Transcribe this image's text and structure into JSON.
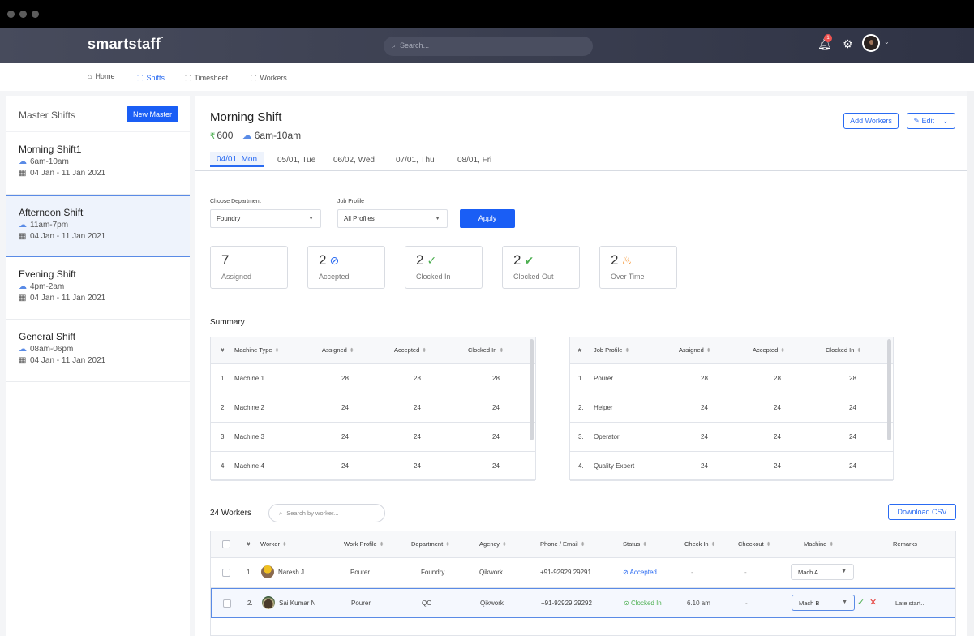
{
  "app": {
    "brand": "smartstaff",
    "search_placeholder": "Search...",
    "notification_count": "1"
  },
  "nav": {
    "items": [
      {
        "label": "Home",
        "icon": "home-icon"
      },
      {
        "label": "Shifts",
        "icon": "grid-icon",
        "active": true
      },
      {
        "label": "Timesheet",
        "icon": "grid-icon"
      },
      {
        "label": "Workers",
        "icon": "grid-icon"
      }
    ]
  },
  "sidebar": {
    "title": "Master Shifts",
    "new_button": "New Master",
    "shifts": [
      {
        "name": "Morning Shift1",
        "time": "6am-10am",
        "dates": "04 Jan - 11 Jan 2021"
      },
      {
        "name": "Afternoon Shift",
        "time": "11am-7pm",
        "dates": "04 Jan - 11 Jan 2021",
        "active": true
      },
      {
        "name": "Evening Shift",
        "time": "4pm-2am",
        "dates": "04 Jan - 11 Jan 2021"
      },
      {
        "name": "General Shift",
        "time": "08am-06pm",
        "dates": "04 Jan - 11 Jan 2021"
      }
    ]
  },
  "main": {
    "title": "Morning Shift",
    "rate": "600",
    "time": "6am-10am",
    "add_workers": "Add Workers",
    "edit": "Edit",
    "tabs": [
      "04/01, Mon",
      "05/01, Tue",
      "06/02, Wed",
      "07/01, Thu",
      "08/01, Fri"
    ],
    "filters": {
      "department_label": "Choose Department",
      "department_value": "Foundry",
      "profile_label": "Job Profile",
      "profile_value": "All Profiles",
      "apply": "Apply"
    },
    "stats": [
      {
        "value": "7",
        "label": "Assigned"
      },
      {
        "value": "2",
        "label": "Accepted",
        "icon": "check-circle-icon",
        "color": "#2a6bf2"
      },
      {
        "value": "2",
        "label": "Clocked In",
        "icon": "dashed-check-icon",
        "color": "#4caf50"
      },
      {
        "value": "2",
        "label": "Clocked Out",
        "icon": "filled-check-icon",
        "color": "#4caf50"
      },
      {
        "value": "2",
        "label": "Over Time",
        "icon": "flame-icon",
        "color": "#f57c00"
      }
    ],
    "summary_title": "Summary",
    "machine_table": {
      "headers": [
        "#",
        "Machine Type",
        "Assigned",
        "Accepted",
        "Clocked In"
      ],
      "rows": [
        [
          "1.",
          "Machine 1",
          "28",
          "28",
          "28"
        ],
        [
          "2.",
          "Machine 2",
          "24",
          "24",
          "24"
        ],
        [
          "3.",
          "Machine 3",
          "24",
          "24",
          "24"
        ],
        [
          "4.",
          "Machine 4",
          "24",
          "24",
          "24"
        ]
      ]
    },
    "profile_table": {
      "headers": [
        "#",
        "Job Profile",
        "Assigned",
        "Accepted",
        "Clocked In"
      ],
      "rows": [
        [
          "1.",
          "Pourer",
          "28",
          "28",
          "28"
        ],
        [
          "2.",
          "Helper",
          "24",
          "24",
          "24"
        ],
        [
          "3.",
          "Operator",
          "24",
          "24",
          "24"
        ],
        [
          "4.",
          "Quality Expert",
          "24",
          "24",
          "24"
        ]
      ]
    },
    "workers": {
      "count_label": "24 Workers",
      "search_placeholder": "Search by worker...",
      "download": "Download CSV",
      "headers": [
        "#",
        "Worker",
        "Work Profile",
        "Department",
        "Agency",
        "Phone / Email",
        "Status",
        "Check In",
        "Checkout",
        "Machine",
        "Remarks"
      ],
      "rows": [
        {
          "num": "1.",
          "name": "Naresh J",
          "profile": "Pourer",
          "dept": "Foundry",
          "agency": "Qikwork",
          "phone": "+91-92929 29291",
          "status": "Accepted",
          "checkin": "-",
          "checkout": "-",
          "machine": "Mach A",
          "remarks": ""
        },
        {
          "num": "2.",
          "name": "Sai Kumar N",
          "profile": "Pourer",
          "dept": "QC",
          "agency": "Qikwork",
          "phone": "+91-92929 29292",
          "status": "Clocked In",
          "checkin": "6.10 am",
          "checkout": "-",
          "machine": "Mach B",
          "remarks": "Late start..."
        }
      ]
    }
  }
}
